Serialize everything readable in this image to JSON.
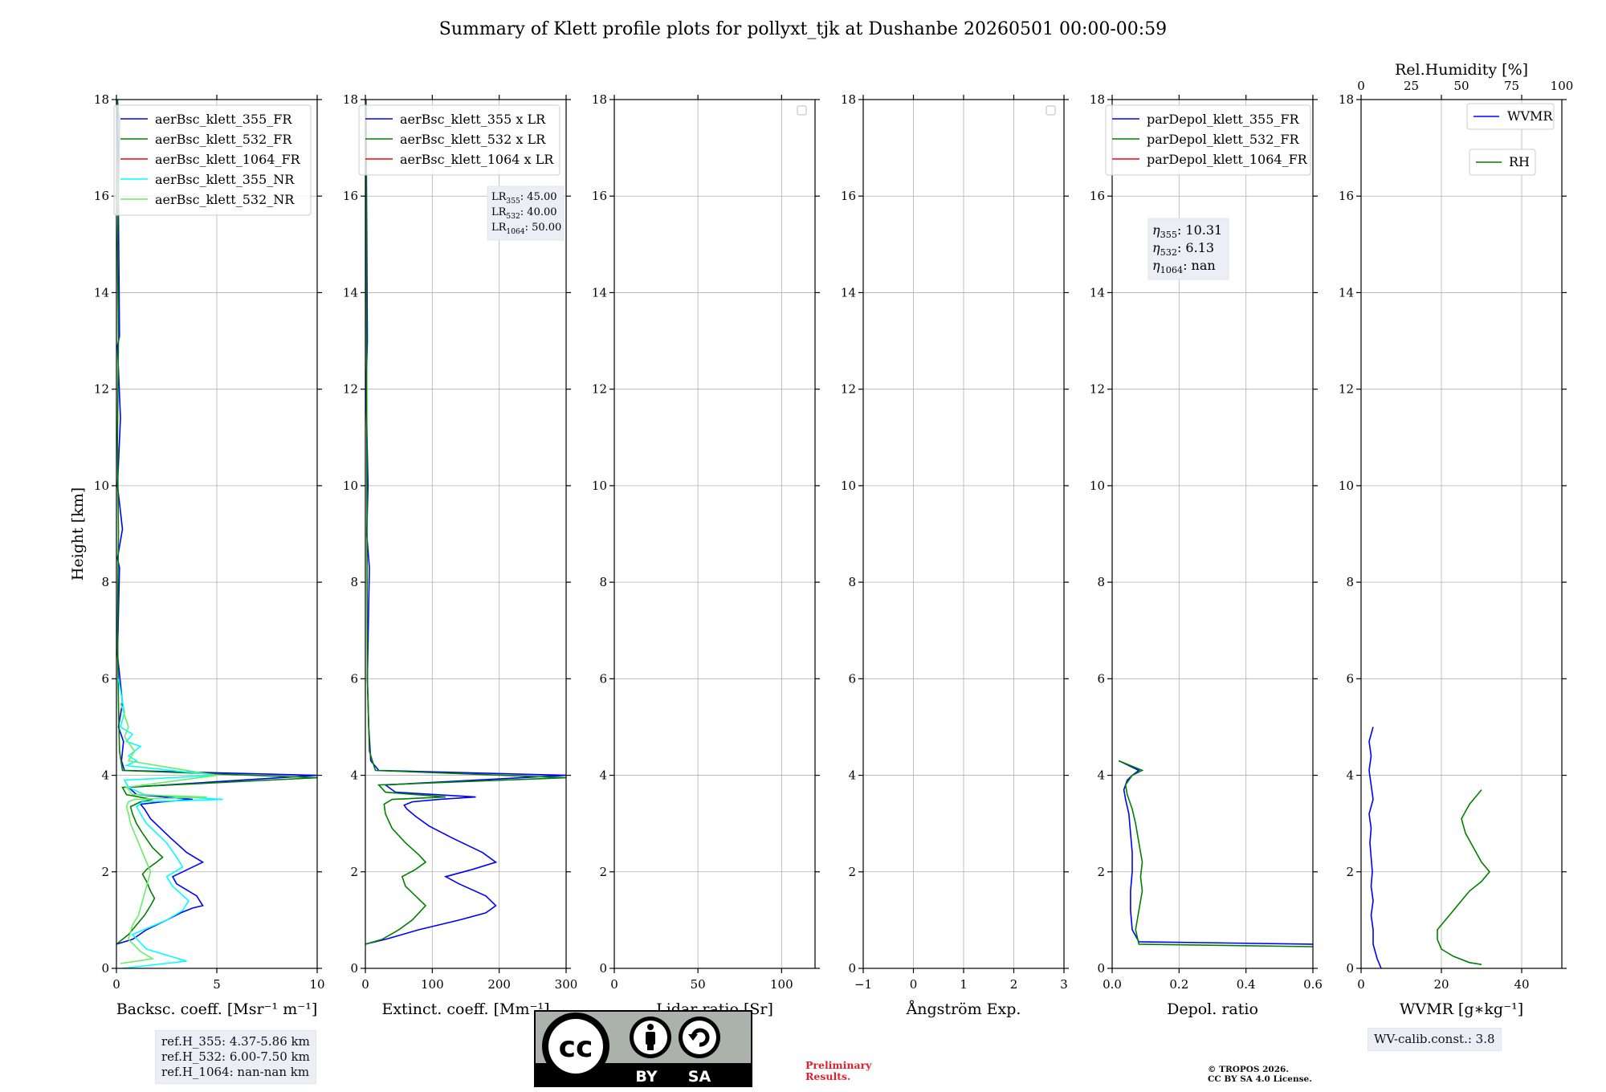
{
  "title": "Summary of Klett profile plots for pollyxt_tjk at Dushanbe 20260501 00:00-00:59",
  "colors": {
    "b355": "#0000ff",
    "g532": "#008000",
    "r1064": "#ff0000",
    "c355nr": "#00ffff",
    "lg532nr": "#66ee66"
  },
  "chart_data": [
    {
      "type": "line",
      "ylabel": "Height [km]",
      "xlabel": "Backsc. coeff. [Msr⁻¹ m⁻¹]",
      "xlim": [
        0,
        10
      ],
      "xticks": [
        0,
        5,
        10
      ],
      "ylim": [
        0,
        18
      ],
      "yticks": [
        0,
        2,
        4,
        6,
        8,
        10,
        12,
        14,
        16,
        18
      ],
      "grid": true,
      "legend": {
        "position": "top-right",
        "entries": [
          "aerBsc_klett_355_FR",
          "aerBsc_klett_532_FR",
          "aerBsc_klett_1064_FR",
          "aerBsc_klett_355_NR",
          "aerBsc_klett_532_NR"
        ]
      },
      "series": [
        {
          "name": "aerBsc_klett_355_FR",
          "color": "#0000ff",
          "x": [
            0,
            0.8,
            1.5,
            2.5,
            3.2,
            3.8,
            4.3,
            4.0,
            3.0,
            2.8,
            3.8,
            4.3,
            3.5,
            2.7,
            2.2,
            1.7,
            1.4,
            1.2,
            2.3,
            3.8,
            1.0,
            0.6,
            10,
            0.4,
            0.25,
            0.35,
            0.1,
            0.3,
            0.05,
            0.15,
            0.05,
            0.3,
            0.05,
            0.2,
            0.05,
            0.15,
            0.05
          ],
          "y": [
            0.5,
            0.6,
            0.8,
            1.0,
            1.15,
            1.25,
            1.3,
            1.5,
            1.75,
            1.9,
            2.1,
            2.2,
            2.4,
            2.7,
            2.9,
            3.1,
            3.3,
            3.4,
            3.45,
            3.5,
            3.6,
            3.75,
            4.0,
            4.1,
            4.3,
            4.7,
            5.0,
            5.5,
            6.5,
            8.3,
            8.5,
            9.1,
            10,
            11.4,
            12.9,
            13.1,
            18
          ]
        },
        {
          "name": "aerBsc_klett_532_FR",
          "color": "#008000",
          "x": [
            0,
            0.6,
            1.0,
            1.4,
            1.7,
            1.9,
            1.7,
            1.5,
            1.3,
            1.5,
            2.0,
            2.3,
            1.8,
            1.3,
            1.0,
            0.8,
            0.7,
            1.2,
            1.8,
            0.5,
            0.3,
            10,
            0.3,
            0.15,
            0.1,
            0.05,
            0.1,
            0.05,
            0.1,
            0.05,
            0.15,
            0.05
          ],
          "y": [
            0.5,
            0.7,
            0.9,
            1.1,
            1.3,
            1.45,
            1.6,
            1.8,
            1.95,
            2.05,
            2.2,
            2.3,
            2.5,
            2.8,
            3.0,
            3.2,
            3.35,
            3.45,
            3.5,
            3.6,
            3.75,
            3.95,
            4.1,
            4.5,
            5.5,
            7.0,
            9.0,
            11.0,
            13.0,
            15.0,
            17.5,
            18
          ]
        },
        {
          "name": "aerBsc_klett_1064_FR",
          "color": "#ff0000",
          "x": [],
          "y": []
        },
        {
          "name": "aerBsc_klett_355_NR",
          "color": "#00ffff",
          "x": [
            0.3,
            3.5,
            1.5,
            0.8,
            2.5,
            3.3,
            3.6,
            2.8,
            2.5,
            3.3,
            3.0,
            2.5,
            2.0,
            1.5,
            1.2,
            1.0,
            1.3,
            5.3,
            1.4,
            0.6,
            0.4,
            5,
            0.5,
            1.0,
            0.6,
            1.2,
            0.5,
            0.8,
            0.2,
            0.4,
            0.1
          ],
          "y": [
            0,
            0.15,
            0.4,
            0.7,
            1.0,
            1.2,
            1.4,
            1.7,
            1.9,
            2.1,
            2.3,
            2.6,
            2.8,
            3.0,
            3.2,
            3.35,
            3.45,
            3.5,
            3.6,
            3.75,
            3.9,
            4.0,
            4.2,
            4.3,
            4.4,
            4.6,
            4.7,
            4.85,
            5.0,
            5.3,
            6.0
          ]
        },
        {
          "name": "aerBsc_klett_532_NR",
          "color": "#66ee66",
          "x": [
            0.2,
            1.8,
            1.2,
            0.6,
            0.8,
            1.1,
            1.3,
            1.5,
            1.7,
            1.4,
            1.2,
            0.9,
            0.7,
            0.6,
            0.5,
            0.6,
            0.9,
            4.5,
            0.8,
            0.5,
            5,
            0.6,
            0.9,
            0.4,
            0.6,
            0.2
          ],
          "y": [
            0.1,
            0.2,
            0.35,
            0.6,
            0.9,
            1.1,
            1.4,
            1.7,
            2.0,
            2.3,
            2.5,
            2.8,
            3.0,
            3.2,
            3.35,
            3.45,
            3.5,
            3.55,
            3.6,
            3.75,
            4.0,
            4.3,
            4.5,
            4.8,
            5.0,
            5.5
          ]
        }
      ],
      "annotation": [
        "ref.H_355: 4.37-5.86 km",
        "ref.H_532: 6.00-7.50 km",
        "ref.H_1064: nan-nan km"
      ]
    },
    {
      "type": "line",
      "xlabel": "Extinct. coeff. [Mm⁻¹]",
      "xlim": [
        0,
        300
      ],
      "xticks": [
        0,
        100,
        200,
        300
      ],
      "ylim": [
        0,
        18
      ],
      "grid": true,
      "legend": {
        "position": "top-right",
        "entries": [
          "aerBsc_klett_355 x LR",
          "aerBsc_klett_532 x LR",
          "aerBsc_klett_1064 x LR"
        ]
      },
      "series": [
        {
          "name": "aerBsc_klett_355 x LR",
          "color": "#0000ff",
          "x": [
            0,
            30,
            80,
            140,
            180,
            195,
            180,
            140,
            120,
            160,
            195,
            175,
            130,
            95,
            75,
            62,
            58,
            70,
            110,
            165,
            45,
            30,
            300,
            20,
            8,
            5,
            3,
            6,
            2,
            4,
            1,
            3,
            1
          ],
          "y": [
            0.5,
            0.6,
            0.8,
            1.0,
            1.15,
            1.3,
            1.5,
            1.75,
            1.9,
            2.05,
            2.2,
            2.4,
            2.7,
            2.95,
            3.15,
            3.3,
            3.38,
            3.45,
            3.5,
            3.55,
            3.65,
            3.8,
            4.0,
            4.1,
            4.3,
            5.0,
            6.0,
            8.3,
            9.0,
            10,
            12,
            13,
            18
          ]
        },
        {
          "name": "aerBsc_klett_532 x LR",
          "color": "#008000",
          "x": [
            0,
            25,
            50,
            70,
            80,
            90,
            75,
            60,
            55,
            75,
            90,
            80,
            60,
            40,
            30,
            28,
            40,
            120,
            30,
            20,
            300,
            15,
            6,
            3,
            1
          ],
          "y": [
            0.5,
            0.6,
            0.8,
            1.0,
            1.15,
            1.3,
            1.5,
            1.7,
            1.9,
            2.05,
            2.2,
            2.35,
            2.6,
            2.9,
            3.2,
            3.4,
            3.5,
            3.55,
            3.65,
            3.8,
            3.95,
            4.1,
            4.5,
            6.0,
            18
          ]
        },
        {
          "name": "aerBsc_klett_1064 x LR",
          "color": "#ff0000",
          "x": [],
          "y": []
        }
      ],
      "annotation": [
        {
          "sym": "LR",
          "sub": "355",
          "val": ": 45.00"
        },
        {
          "sym": "LR",
          "sub": "532",
          "val": ": 40.00"
        },
        {
          "sym": "LR",
          "sub": "1064",
          "val": ": 50.00"
        }
      ]
    },
    {
      "type": "line",
      "xlabel": "Lidar ratio [Sr]",
      "xlim": [
        0,
        120
      ],
      "xticks": [
        0,
        50,
        100
      ],
      "ylim": [
        0,
        18
      ],
      "grid": true,
      "legend": {
        "position": "top-right",
        "entries": []
      },
      "series": []
    },
    {
      "type": "line",
      "xlabel": "Ångström Exp.",
      "xlim": [
        -1,
        3
      ],
      "xticks": [
        -1,
        0,
        1,
        2,
        3
      ],
      "ylim": [
        0,
        18
      ],
      "grid": true,
      "legend": {
        "position": "top-right",
        "entries": []
      },
      "series": []
    },
    {
      "type": "line",
      "xlabel": "Depol. ratio",
      "xlim": [
        0,
        0.6
      ],
      "xticks": [
        0.0,
        0.2,
        0.4,
        0.6
      ],
      "ylim": [
        0,
        18
      ],
      "grid": true,
      "legend": {
        "position": "top-left",
        "entries": [
          "parDepol_klett_355_FR",
          "parDepol_klett_532_FR",
          "parDepol_klett_1064_FR"
        ]
      },
      "series": [
        {
          "name": "parDepol_klett_355_FR",
          "color": "#0000ff",
          "x": [
            0.6,
            0.08,
            0.06,
            0.055,
            0.055,
            0.06,
            0.06,
            0.055,
            0.05,
            0.04,
            0.035,
            0.045,
            0.06,
            0.08,
            0.02
          ],
          "y": [
            0.5,
            0.55,
            0.8,
            1.2,
            1.6,
            2.0,
            2.4,
            2.8,
            3.2,
            3.5,
            3.7,
            3.9,
            4.0,
            4.1,
            4.3
          ]
        },
        {
          "name": "parDepol_klett_532_FR",
          "color": "#008000",
          "x": [
            0.6,
            0.08,
            0.07,
            0.08,
            0.09,
            0.085,
            0.09,
            0.08,
            0.07,
            0.06,
            0.045,
            0.04,
            0.06,
            0.09,
            0.02
          ],
          "y": [
            0.45,
            0.5,
            0.8,
            1.2,
            1.6,
            1.9,
            2.2,
            2.6,
            3.0,
            3.3,
            3.6,
            3.8,
            4.0,
            4.1,
            4.3
          ]
        },
        {
          "name": "parDepol_klett_1064_FR",
          "color": "#ff0000",
          "x": [],
          "y": []
        }
      ],
      "annotation": [
        {
          "sym": "η",
          "sub": "355",
          "val": ": 10.31"
        },
        {
          "sym": "η",
          "sub": "532",
          "val": ": 6.13"
        },
        {
          "sym": "η",
          "sub": "1064",
          "val": ": nan"
        }
      ]
    },
    {
      "type": "line",
      "xlabel": "WVMR [g∗kg⁻¹]",
      "xlim": [
        0,
        50
      ],
      "xticks": [
        0,
        20,
        40
      ],
      "ylim": [
        0,
        18
      ],
      "grid": true,
      "x2label": "Rel.Humidity [%]",
      "x2lim": [
        0,
        100
      ],
      "x2ticks": [
        0,
        25,
        50,
        75,
        100
      ],
      "legend": {
        "position": "top-right",
        "entries": [
          "WVMR",
          "RH"
        ]
      },
      "series": [
        {
          "name": "WVMR",
          "color": "#0000ff",
          "x": [
            5,
            4,
            3,
            3,
            2.5,
            3,
            2.5,
            2.8,
            2.5,
            2.2,
            2.5,
            2,
            3,
            2.5,
            2,
            2.5,
            2,
            3
          ],
          "y": [
            0,
            0.2,
            0.5,
            0.8,
            1.1,
            1.4,
            1.7,
            2.0,
            2.3,
            2.6,
            2.9,
            3.2,
            3.5,
            3.8,
            4.1,
            4.4,
            4.7,
            5.0
          ]
        },
        {
          "name": "RH",
          "color": "#008000",
          "x": [
            30,
            27,
            23,
            20,
            19,
            19,
            21,
            23,
            25,
            27,
            30,
            32,
            30,
            28,
            26,
            25,
            27,
            30
          ],
          "y": [
            0.08,
            0.12,
            0.25,
            0.4,
            0.6,
            0.8,
            1.0,
            1.2,
            1.4,
            1.6,
            1.8,
            2.0,
            2.2,
            2.5,
            2.8,
            3.1,
            3.4,
            3.7
          ]
        }
      ],
      "annotation": [
        "WV-calib.const.: 3.8"
      ]
    }
  ],
  "footer": {
    "preliminary": "Preliminary\nResults.",
    "copyright": "© TROPOS 2026.\nCC BY SA 4.0 License.",
    "cc_by": "BY",
    "cc_sa": "SA"
  }
}
